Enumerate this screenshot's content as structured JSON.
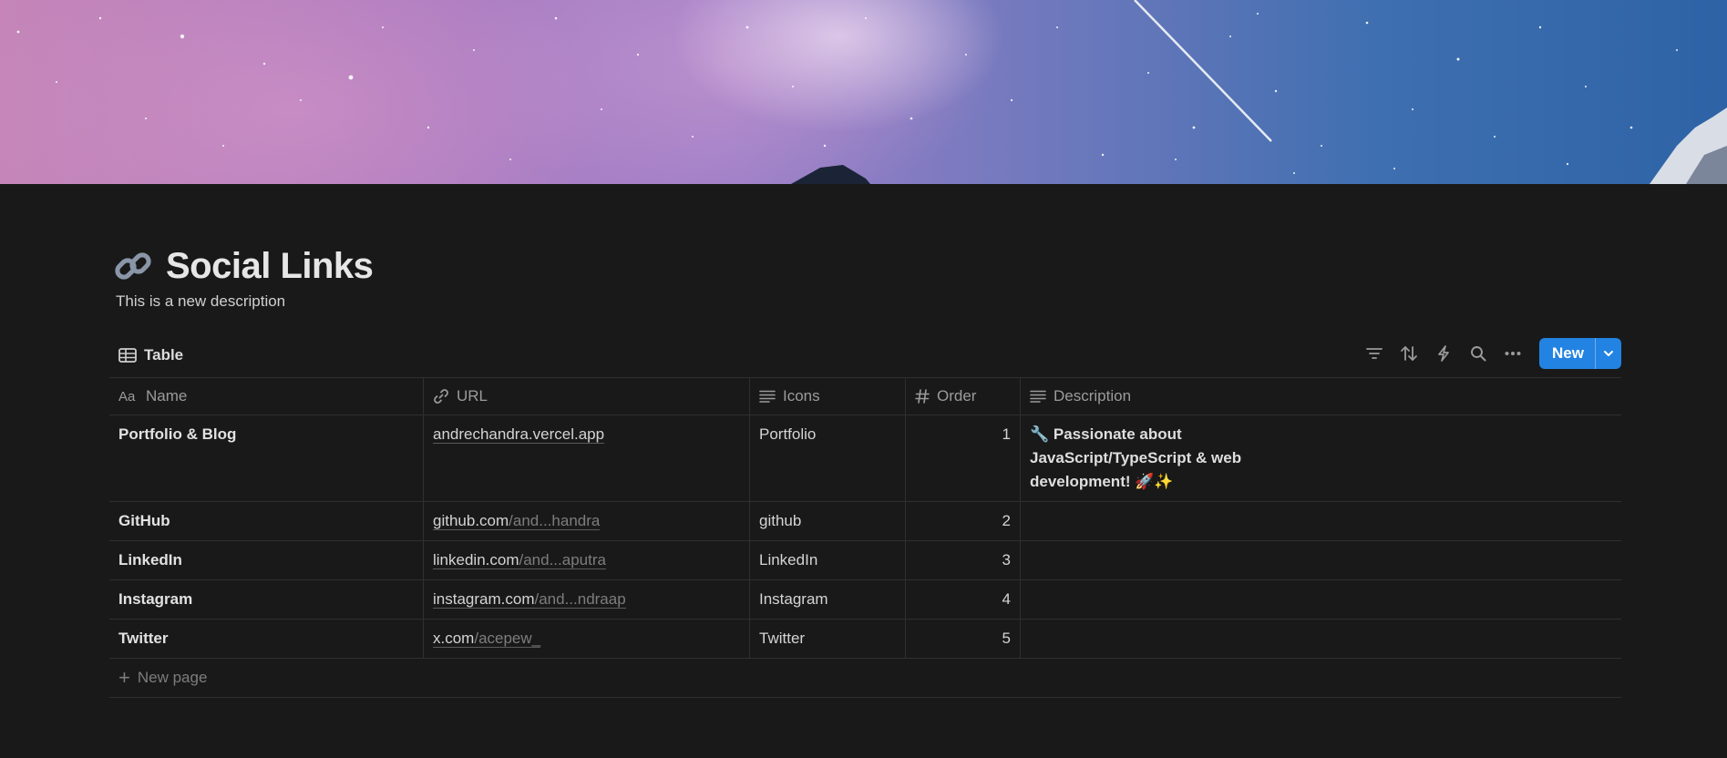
{
  "page": {
    "title": "Social Links",
    "description": "This is a new description",
    "icon": "link-icon"
  },
  "view": {
    "label": "Table",
    "icon": "table-icon"
  },
  "toolbar": {
    "icons": [
      "filter-icon",
      "sort-icon",
      "lightning-icon",
      "search-icon",
      "more-icon"
    ],
    "new_label": "New",
    "accent": "#2383e2"
  },
  "table": {
    "columns": [
      {
        "label": "Name",
        "icon": "text-type-icon"
      },
      {
        "label": "URL",
        "icon": "link-icon"
      },
      {
        "label": "Icons",
        "icon": "text-lines-icon"
      },
      {
        "label": "Order",
        "icon": "hash-icon"
      },
      {
        "label": "Description",
        "icon": "text-lines-icon"
      }
    ],
    "rows": [
      {
        "name": "Portfolio & Blog",
        "url_host": "andrechandra.vercel.app",
        "url_path": "",
        "icons": "Portfolio",
        "order": "1",
        "description": "🔧 Passionate about JavaScript/TypeScript & web development! 🚀✨"
      },
      {
        "name": "GitHub",
        "url_host": "github.com",
        "url_path": "/and...handra",
        "icons": "github",
        "order": "2",
        "description": ""
      },
      {
        "name": "LinkedIn",
        "url_host": "linkedin.com",
        "url_path": "/and...aputra",
        "icons": "LinkedIn",
        "order": "3",
        "description": ""
      },
      {
        "name": "Instagram",
        "url_host": "instagram.com",
        "url_path": "/and...ndraap",
        "icons": "Instagram",
        "order": "4",
        "description": ""
      },
      {
        "name": "Twitter",
        "url_host": "x.com",
        "url_path": "/acepew_",
        "icons": "Twitter",
        "order": "5",
        "description": ""
      }
    ],
    "new_page_label": "New page"
  },
  "colors": {
    "background": "#191919",
    "border": "#2f2f2f",
    "muted_text": "#9b9b9b"
  }
}
